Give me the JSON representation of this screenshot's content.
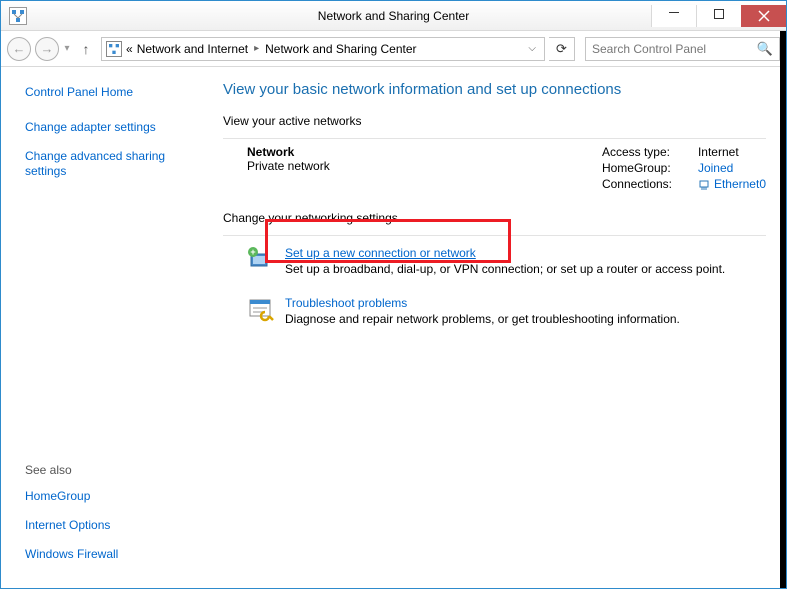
{
  "window": {
    "title": "Network and Sharing Center"
  },
  "breadcrumbs": {
    "prefix": "«",
    "item1": "Network and Internet",
    "item2": "Network and Sharing Center"
  },
  "search": {
    "placeholder": "Search Control Panel"
  },
  "sidebar": {
    "home": "Control Panel Home",
    "adapter": "Change adapter settings",
    "advanced": "Change advanced sharing settings",
    "seealso": "See also",
    "homegroup": "HomeGroup",
    "internet_options": "Internet Options",
    "firewall": "Windows Firewall"
  },
  "main": {
    "heading": "View your basic network information and set up connections",
    "active_label": "View your active networks",
    "network": {
      "name": "Network",
      "type": "Private network",
      "access_label": "Access type:",
      "access_value": "Internet",
      "homegroup_label": "HomeGroup:",
      "homegroup_value": "Joined",
      "connections_label": "Connections:",
      "connections_value": "Ethernet0"
    },
    "change_label": "Change your networking settings",
    "setup": {
      "title": "Set up a new connection or network",
      "desc": "Set up a broadband, dial-up, or VPN connection; or set up a router or access point."
    },
    "troubleshoot": {
      "title": "Troubleshoot problems",
      "desc": "Diagnose and repair network problems, or get troubleshooting information."
    }
  }
}
